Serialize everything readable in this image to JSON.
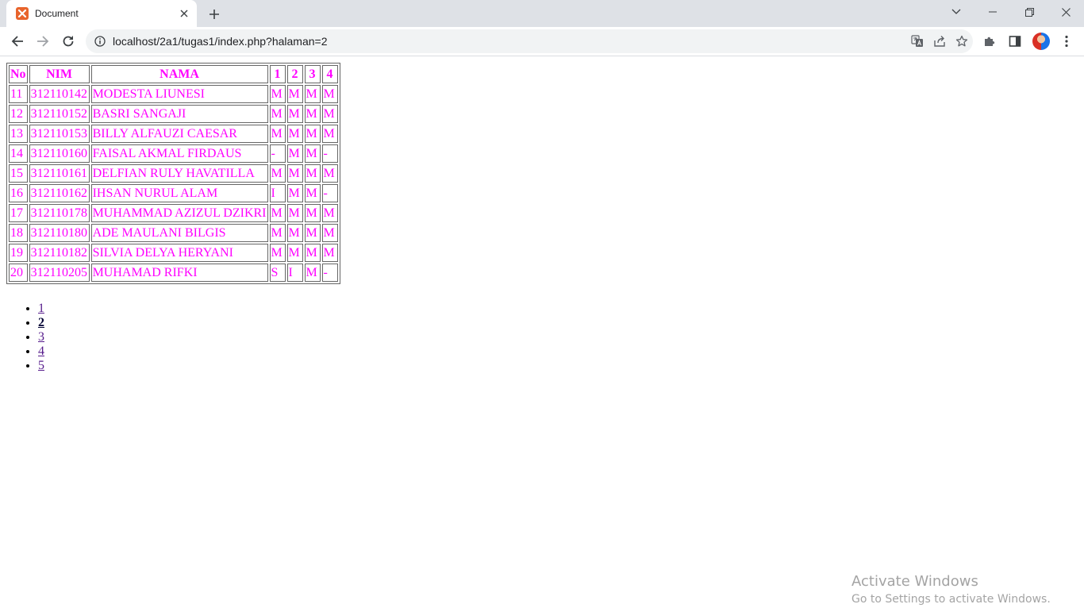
{
  "browser": {
    "tab_title": "Document",
    "url": "localhost/2a1/tugas1/index.php?halaman=2",
    "icons": {
      "tab_favicon": "xampp-favicon-icon",
      "close": "close-icon",
      "new_tab": "plus-icon",
      "back": "back-arrow-icon",
      "forward": "forward-arrow-icon",
      "reload": "reload-icon",
      "site_info": "info-icon",
      "translate": "translate-icon",
      "share": "share-icon",
      "bookmark": "star-icon",
      "extensions": "puzzle-icon",
      "side_panel": "side-panel-icon",
      "menu": "more-vert-icon"
    }
  },
  "table": {
    "headers": [
      "No",
      "NIM",
      "NAMA",
      "1",
      "2",
      "3",
      "4"
    ],
    "rows": [
      [
        "11",
        "312110142",
        "MODESTA LIUNESI",
        "M",
        "M",
        "M",
        "M"
      ],
      [
        "12",
        "312110152",
        "BASRI SANGAJI",
        "M",
        "M",
        "M",
        "M"
      ],
      [
        "13",
        "312110153",
        "BILLY ALFAUZI CAESAR",
        "M",
        "M",
        "M",
        "M"
      ],
      [
        "14",
        "312110160",
        "FAISAL AKMAL FIRDAUS",
        "-",
        "M",
        "M",
        "-"
      ],
      [
        "15",
        "312110161",
        "DELFIAN RULY HAVATILLA",
        "M",
        "M",
        "M",
        "M"
      ],
      [
        "16",
        "312110162",
        "IHSAN NURUL ALAM",
        "I",
        "M",
        "M",
        "-"
      ],
      [
        "17",
        "312110178",
        "MUHAMMAD AZIZUL DZIKRI",
        "M",
        "M",
        "M",
        "M"
      ],
      [
        "18",
        "312110180",
        "ADE MAULANI BILGIS",
        "M",
        "M",
        "M",
        "M"
      ],
      [
        "19",
        "312110182",
        "SILVIA DELYA HERYANI",
        "M",
        "M",
        "M",
        "M"
      ],
      [
        "20",
        "312110205",
        "MUHAMAD RIFKI",
        "S",
        "I",
        "M",
        "-"
      ]
    ],
    "text_color": "#ff00ff"
  },
  "pagination": {
    "pages": [
      "1",
      "2",
      "3",
      "4",
      "5"
    ],
    "current": "2"
  },
  "watermark": {
    "title": "Activate Windows",
    "subtitle": "Go to Settings to activate Windows."
  }
}
